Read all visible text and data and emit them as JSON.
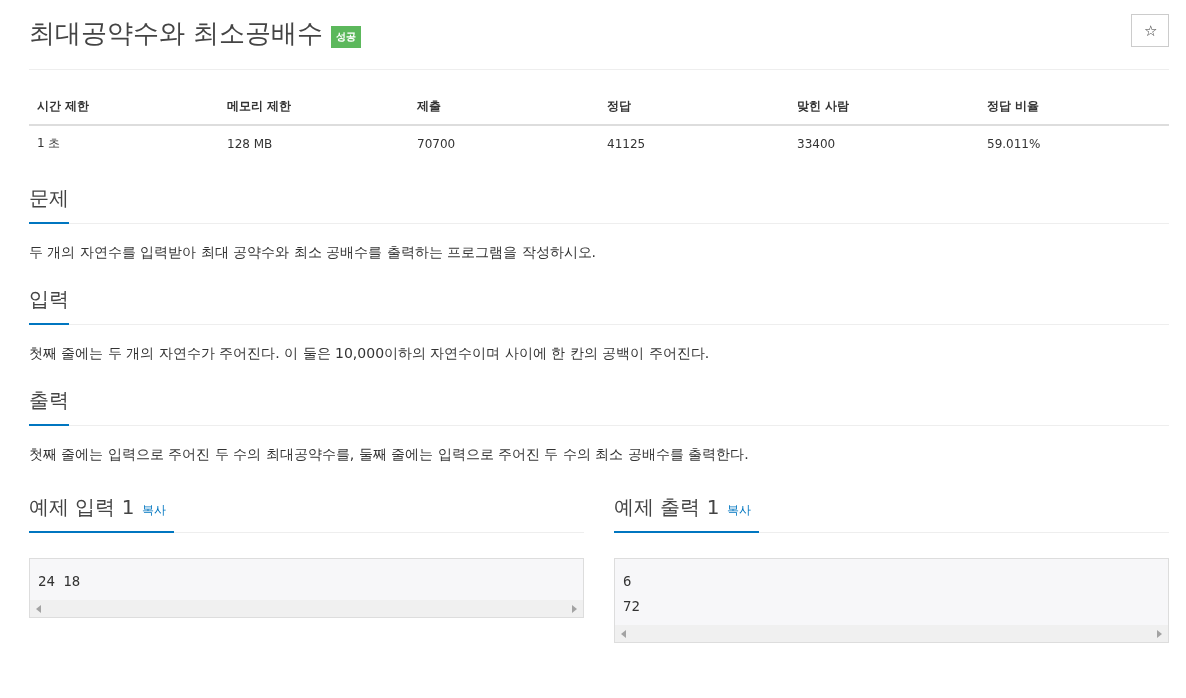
{
  "problem": {
    "title": "최대공약수와 최소공배수",
    "badge": "성공",
    "star_button": "☆"
  },
  "stats": {
    "columns": [
      "시간 제한",
      "메모리 제한",
      "제출",
      "정답",
      "맞힌 사람",
      "정답 비율"
    ],
    "rows": [
      [
        "1 초",
        "128 MB",
        "70700",
        "41125",
        "33400",
        "59.011%"
      ]
    ]
  },
  "sections": [
    {
      "heading": "문제",
      "text": "두 개의 자연수를 입력받아 최대 공약수와 최소 공배수를 출력하는 프로그램을 작성하시오."
    },
    {
      "heading": "입력",
      "text": "첫째 줄에는 두 개의 자연수가 주어진다. 이 둘은 10,000이하의 자연수이며 사이에 한 칸의 공백이 주어진다."
    },
    {
      "heading": "출력",
      "text": "첫째 줄에는 입력으로 주어진 두 수의 최대공약수를, 둘째 줄에는 입력으로 주어진 두 수의 최소 공배수를 출력한다."
    }
  ],
  "samples": [
    {
      "heading": "예제 입력 1",
      "copy": "복사",
      "lines": [
        "24  18"
      ]
    },
    {
      "heading": "예제 출력 1",
      "copy": "복사",
      "lines": [
        "6",
        "72"
      ]
    }
  ]
}
